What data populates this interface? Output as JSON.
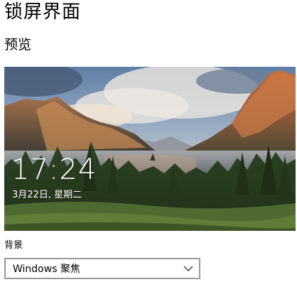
{
  "page": {
    "title": "锁屏界面"
  },
  "preview": {
    "section_title": "预览",
    "time": "17:24",
    "date": "3月22日, 星期二"
  },
  "background": {
    "label": "背景",
    "selected": "Windows 聚焦",
    "dropdown_icon": "chevron-down-icon"
  }
}
